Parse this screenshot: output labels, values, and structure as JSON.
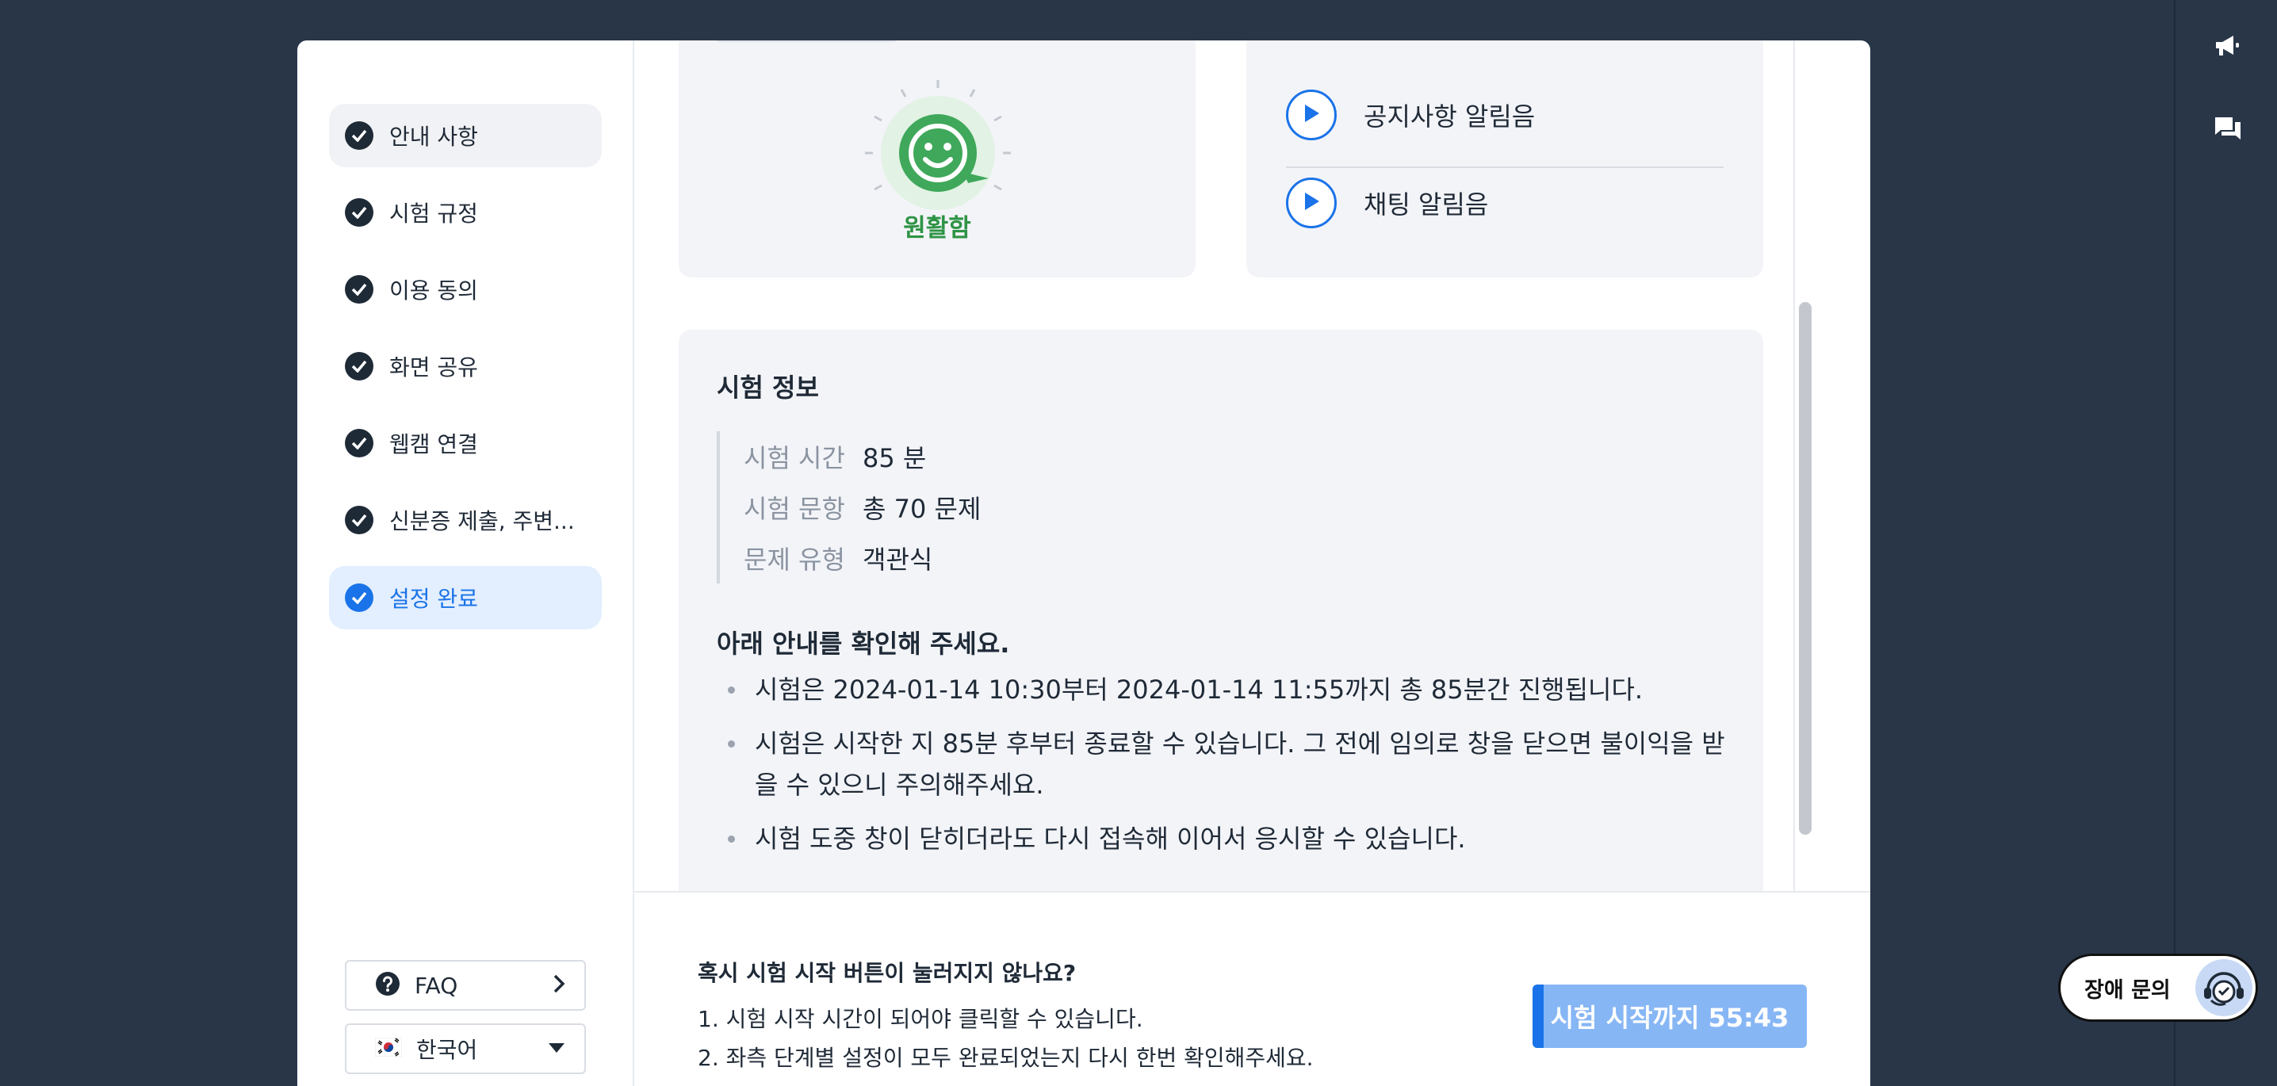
{
  "sidebar": {
    "steps": [
      {
        "label": "안내 사항"
      },
      {
        "label": "시험 규정"
      },
      {
        "label": "이용 동의"
      },
      {
        "label": "화면 공유"
      },
      {
        "label": "웹캠 연결"
      },
      {
        "label": "신분증 제출, 주변..."
      },
      {
        "label": "설정 완료"
      }
    ],
    "faq_label": "FAQ",
    "language_label": "한국어"
  },
  "network": {
    "status": "원활함"
  },
  "sounds": {
    "items": [
      {
        "label": "공지사항 알림음"
      },
      {
        "label": "채팅 알림음"
      }
    ]
  },
  "exam_info": {
    "title": "시험 정보",
    "rows": [
      {
        "key": "시험 시간",
        "value": "85 분"
      },
      {
        "key": "시험 문항",
        "value": "총 70 문제"
      },
      {
        "key": "문제 유형",
        "value": "객관식"
      }
    ],
    "notice_title": "아래 안내를 확인해 주세요.",
    "notices": [
      "시험은 2024-01-14 10:30부터 2024-01-14 11:55까지 총 85분간 진행됩니다.",
      "시험은 시작한 지 85분 후부터 종료할 수 있습니다. 그 전에 임의로 창을 닫으면 불이익을 받을 수 있으니 주의해주세요.",
      "시험 도중 창이 닫히더라도 다시 접속해 이어서 응시할 수 있습니다."
    ]
  },
  "footer": {
    "help_title": "혹시 시험 시작 버튼이 눌러지지 않나요?",
    "help_lines": [
      "1. 시험 시작 시간이 되어야 클릭할 수 있습니다.",
      "2. 좌측 단계별 설정이 모두 완료되었는지 다시 한번 확인해주세요."
    ],
    "start_button_label": "시험 시작까지 55:43",
    "start_button_progress": 0.04
  },
  "support": {
    "label": "장애 문의"
  },
  "colors": {
    "accent": "#1a73e8",
    "good": "#2e9445",
    "backdrop": "#283648"
  },
  "icons": {
    "rail": [
      "megaphone-icon",
      "chat-icon"
    ],
    "steps": "check-circle-icon",
    "faq": "question-circle-icon",
    "language": "korea-flag-icon",
    "play": "play-icon"
  }
}
